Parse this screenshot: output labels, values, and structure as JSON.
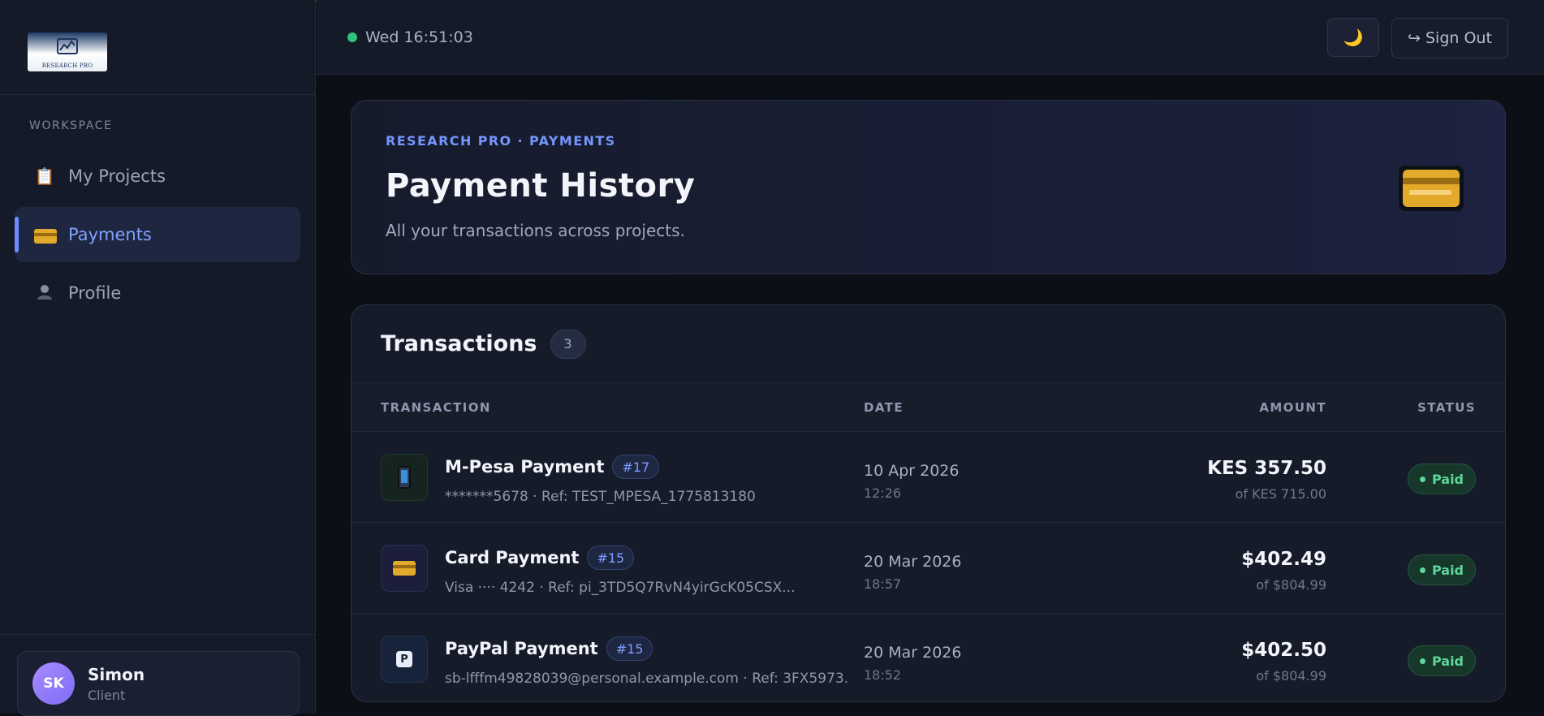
{
  "brand": {
    "logo_text": "RESEARCH PRO"
  },
  "sidebar": {
    "section_label": "WORKSPACE",
    "items": [
      {
        "label": "My Projects",
        "icon": "clipboard-icon",
        "active": false
      },
      {
        "label": "Payments",
        "icon": "credit-card-icon",
        "active": true
      },
      {
        "label": "Profile",
        "icon": "person-icon",
        "active": false
      }
    ],
    "user": {
      "initials": "SK",
      "name": "Simon",
      "role": "Client"
    }
  },
  "header": {
    "clock": "Wed 16:51:03",
    "theme_icon": "🌙",
    "sign_out_icon": "↪",
    "sign_out_label": "Sign Out"
  },
  "hero": {
    "kicker": "RESEARCH PRO · PAYMENTS",
    "title": "Payment History",
    "subtitle": "All your transactions across projects."
  },
  "transactions": {
    "title": "Transactions",
    "count": "3",
    "columns": {
      "transaction": "TRANSACTION",
      "date": "DATE",
      "amount": "AMOUNT",
      "status": "STATUS"
    },
    "rows": [
      {
        "name": "M-Pesa Payment",
        "tag": "#17",
        "meta": "*******5678 · Ref: TEST_MPESA_1775813180",
        "date": "10 Apr 2026",
        "time": "12:26",
        "amount": "KES 357.50",
        "of": "of KES 715.00",
        "status": "Paid",
        "icon": "mobile-phone-icon"
      },
      {
        "name": "Card Payment",
        "tag": "#15",
        "meta": "Visa ···· 4242 · Ref: pi_3TD5Q7RvN4yirGcK05CSX...",
        "date": "20 Mar 2026",
        "time": "18:57",
        "amount": "$402.49",
        "of": "of $804.99",
        "status": "Paid",
        "icon": "credit-card-icon"
      },
      {
        "name": "PayPal Payment",
        "tag": "#15",
        "meta": "sb-lfffm49828039@personal.example.com · Ref: 3FX5973...",
        "date": "20 Mar 2026",
        "time": "18:52",
        "amount": "$402.50",
        "of": "of $804.99",
        "status": "Paid",
        "icon": "parking-p-icon"
      }
    ]
  },
  "colors": {
    "accent": "#7596ff",
    "paid": "#5fd69a",
    "online": "#2ec37a"
  }
}
